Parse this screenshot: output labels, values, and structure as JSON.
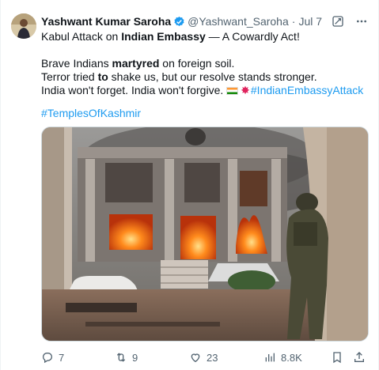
{
  "author": {
    "name": "Yashwant Kumar Saroha",
    "handle": "@Yashwant_Saroha",
    "separator": "·",
    "time": "Jul 7"
  },
  "post": {
    "line1_pre": "Kabul Attack on ",
    "line1_bold": "Indian Embassy",
    "line1_post": " — A Cowardly Act!",
    "line2_pre": "Brave Indians ",
    "line2_bold": "martyred",
    "line2_post": " on foreign soil.",
    "line3_pre": "Terror tried ",
    "line3_bold": "to",
    "line3_post": " shake us, but our resolve stands stronger.",
    "line4_text": "India won't forget. India won't forgive. ",
    "line4_hashtag": "#IndianEmbassyAttack",
    "hashtag2": "#TemplesOfKashmir"
  },
  "actions": {
    "replies": "7",
    "reposts": "9",
    "likes": "23",
    "views": "8.8K"
  },
  "colors": {
    "link": "#1d9bf0",
    "verified": "#1d9bf0",
    "muted": "#536471"
  },
  "icons": [
    "verified-badge-icon",
    "grok-icon",
    "more-icon",
    "reply-icon",
    "repost-icon",
    "like-icon",
    "views-icon",
    "bookmark-icon",
    "share-icon",
    "india-flag-icon",
    "explosion-icon"
  ]
}
